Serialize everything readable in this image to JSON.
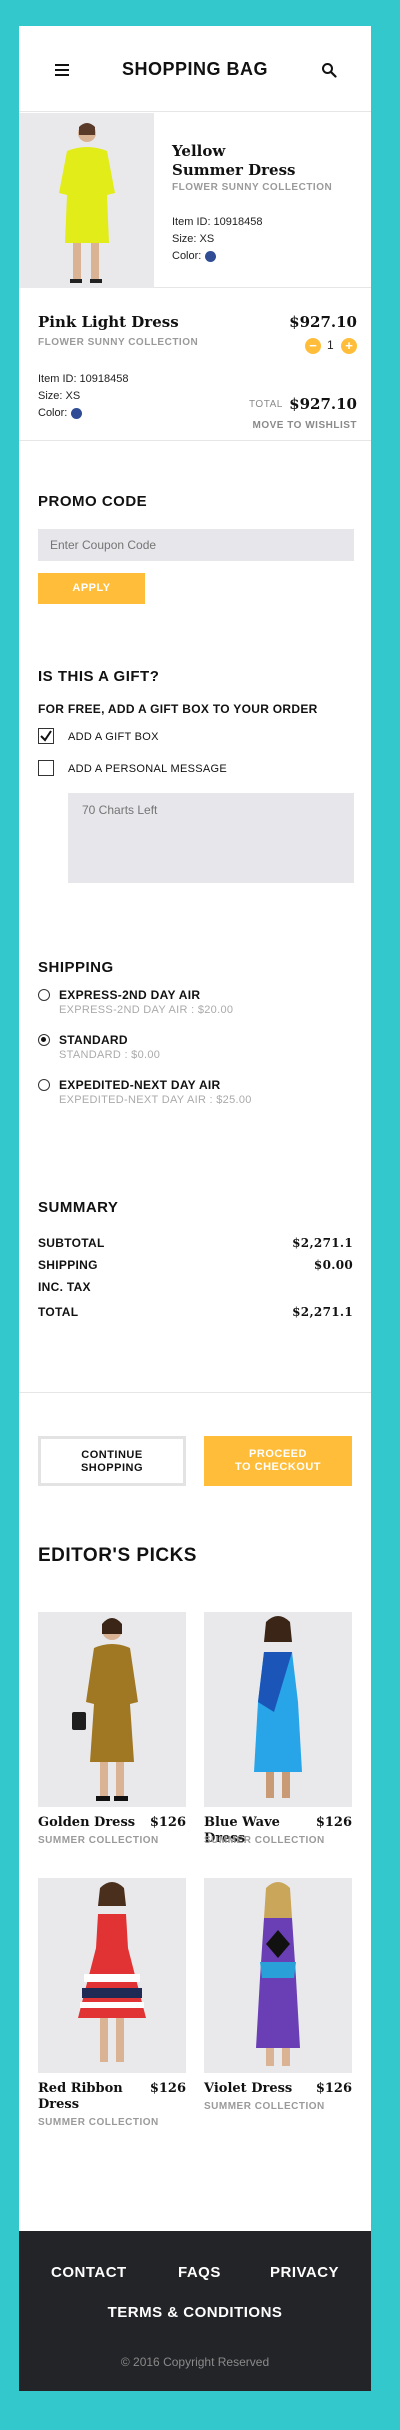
{
  "header": {
    "title": "SHOPPING BAG"
  },
  "cart": {
    "item1": {
      "name_line1": "Yellow",
      "name_line2": "Summer Dress",
      "collection": "FLOWER SUNNY COLLECTION",
      "item_id": "Item ID: 10918458",
      "size": "Size: XS",
      "color_label": "Color:"
    },
    "item2": {
      "name": "Pink Light Dress",
      "collection": "FLOWER SUNNY COLLECTION",
      "price": "$927.10",
      "quantity": "1",
      "item_id": "Item ID: 10918458",
      "size": "Size: XS",
      "color_label": "Color:",
      "total_label": "TOTAL",
      "total_value": "$927.10",
      "wishlist": "MOVE TO WISHLIST"
    },
    "minus": "−",
    "plus": "+"
  },
  "promo": {
    "title": "PROMO CODE",
    "placeholder": "Enter Coupon Code",
    "apply": "APPLY"
  },
  "gift": {
    "title": "IS THIS A GIFT?",
    "subtitle": "FOR FREE, ADD A GIFT BOX TO YOUR ORDER",
    "option1": "ADD A GIFT BOX",
    "option2": "ADD A PERSONAL MESSAGE",
    "message_placeholder": "70 Charts Left"
  },
  "shipping": {
    "title": "SHIPPING",
    "options": [
      {
        "title": "EXPRESS-2ND DAY AIR",
        "sub": "EXPRESS-2ND DAY AIR : $20.00"
      },
      {
        "title": "STANDARD",
        "sub": "STANDARD : $0.00"
      },
      {
        "title": "EXPEDITED-NEXT DAY AIR",
        "sub": "EXPEDITED-NEXT DAY AIR : $25.00"
      }
    ]
  },
  "summary": {
    "title": "SUMMARY",
    "subtotal_label": "SUBTOTAL",
    "subtotal": "$2,271.1",
    "shipping_label": "SHIPPING",
    "shipping": "$0.00",
    "tax_label": "INC. TAX",
    "total_label": "TOTAL",
    "total": "$2,271.1"
  },
  "actions": {
    "continue_line1": "CONTINUE",
    "continue_line2": "SHOPPING",
    "checkout_line1": "PROCEED",
    "checkout_line2": "TO CHECKOUT"
  },
  "picks": {
    "title": "EDITOR'S PICKS",
    "items": [
      {
        "name": "Golden Dress",
        "price": "$126",
        "collection": "SUMMER COLLECTION"
      },
      {
        "name": "Blue Wave Dress",
        "price": "$126",
        "collection": "SUMMER COLLECTION"
      },
      {
        "name": "Red Ribbon Dress",
        "price": "$126",
        "collection": "SUMMER COLLECTION"
      },
      {
        "name": "Violet Dress",
        "price": "$126",
        "collection": "SUMMER COLLECTION"
      }
    ]
  },
  "footer": {
    "contact": "CONTACT",
    "faqs": "FAQS",
    "privacy": "PRIVACY",
    "terms": "TERMS & CONDITIONS",
    "copyright": "© 2016 Copyright Reserved"
  },
  "colors": {
    "background": "#33c9cc",
    "accent": "#ffbd3a",
    "footer": "#232428",
    "swatch": "#2f4c94"
  },
  "icons": {
    "menu": "hamburger-icon",
    "search": "search-icon",
    "check": "check-icon"
  }
}
